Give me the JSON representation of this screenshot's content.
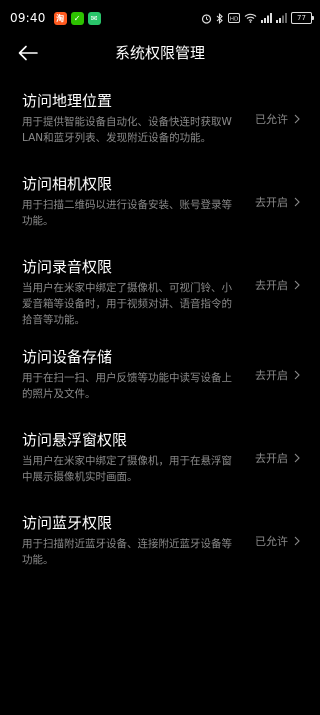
{
  "status_bar": {
    "time": "09:40",
    "battery": "77",
    "app_icons": [
      {
        "name": "taobao-app-icon",
        "color": "#ff5a1f",
        "glyph": "淘"
      },
      {
        "name": "wechat-app-icon",
        "color": "#2dc100",
        "glyph": "✓"
      },
      {
        "name": "message-app-icon",
        "color": "#29c46a",
        "glyph": "✉"
      }
    ]
  },
  "header": {
    "title": "系统权限管理"
  },
  "permissions": [
    {
      "title": "访问地理位置",
      "desc": "用于提供智能设备自动化、设备快连时获取WLAN和蓝牙列表、发现附近设备的功能。",
      "status": "已允许"
    },
    {
      "title": "访问相机权限",
      "desc": "用于扫描二维码以进行设备安装、账号登录等功能。",
      "status": "去开启"
    },
    {
      "title": "访问录音权限",
      "desc": "当用户在米家中绑定了摄像机、可视门铃、小爱音箱等设备时，用于视频对讲、语音指令的拾音等功能。",
      "status": "去开启"
    },
    {
      "title": "访问设备存储",
      "desc": "用于在扫一扫、用户反馈等功能中读写设备上的照片及文件。",
      "status": "去开启"
    },
    {
      "title": "访问悬浮窗权限",
      "desc": "当用户在米家中绑定了摄像机，用于在悬浮窗中展示摄像机实时画面。",
      "status": "去开启"
    },
    {
      "title": "访问蓝牙权限",
      "desc": "用于扫描附近蓝牙设备、连接附近蓝牙设备等功能。",
      "status": "已允许"
    }
  ]
}
